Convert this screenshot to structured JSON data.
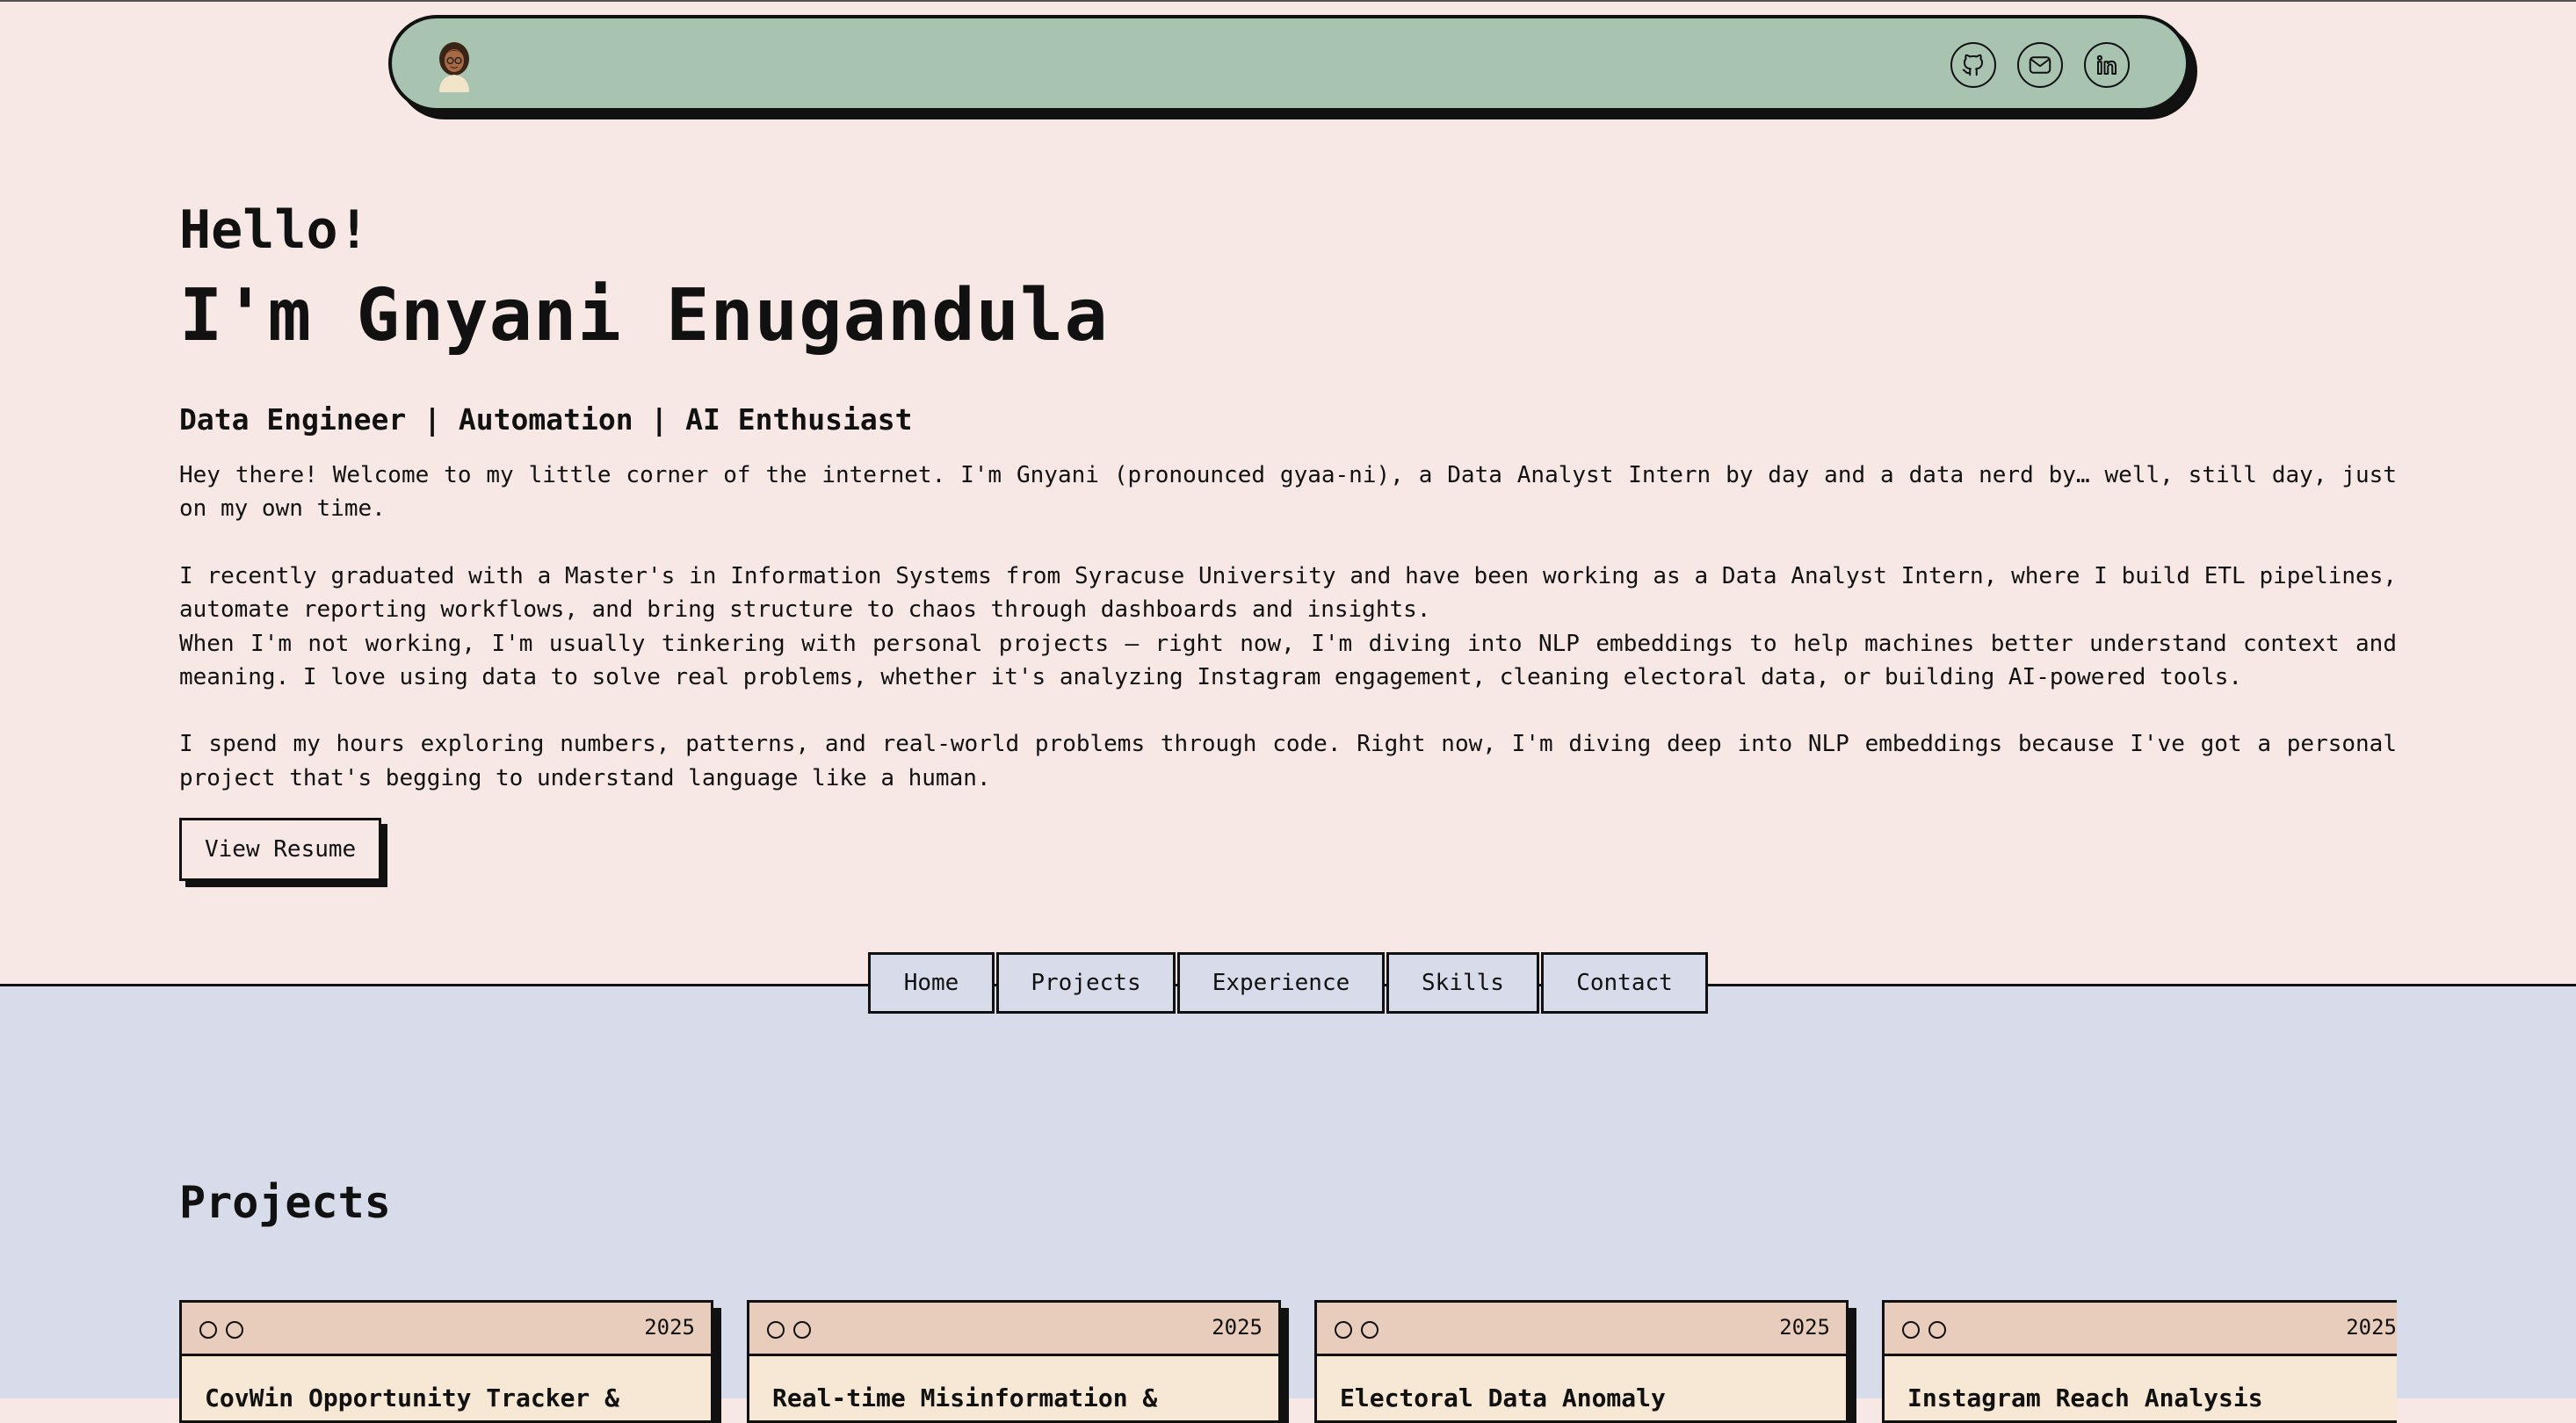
{
  "header": {
    "avatar_icon": "avatar-emoji-icon",
    "social": [
      {
        "name": "github",
        "icon": "github-icon"
      },
      {
        "name": "email",
        "icon": "mail-icon"
      },
      {
        "name": "linkedin",
        "icon": "linkedin-icon"
      }
    ]
  },
  "hero": {
    "greeting": "Hello!",
    "name": "I'm Gnyani Enugandula",
    "tagline": "Data Engineer | Automation | AI Enthusiast",
    "para1": "Hey there! Welcome to my little corner of the internet. I'm Gnyani (pronounced gyaa-ni), a Data Analyst Intern by day and a data nerd by… well, still day, just on my own time.",
    "para2": "I recently graduated with a Master's in Information Systems from Syracuse University and have been working as a Data Analyst Intern, where I build ETL pipelines, automate reporting workflows, and bring structure to chaos through dashboards and insights.",
    "para3": "When I'm not working, I'm usually tinkering with personal projects — right now, I'm diving into NLP embeddings to help machines better understand context and meaning. I love using data to solve real problems, whether it's analyzing Instagram engagement, cleaning electoral data, or building AI-powered tools.",
    "para4": "I spend my hours exploring numbers, patterns, and real-world problems through code. Right now, I'm diving deep into NLP embeddings because I've got a personal project that's begging to understand language like a human.",
    "resume_label": "View Resume"
  },
  "nav": {
    "items": [
      {
        "label": "Home"
      },
      {
        "label": "Projects"
      },
      {
        "label": "Experience"
      },
      {
        "label": "Skills"
      },
      {
        "label": "Contact"
      }
    ]
  },
  "projects": {
    "title": "Projects",
    "cards": [
      {
        "year": "2025",
        "title": "CovWin Opportunity Tracker &"
      },
      {
        "year": "2025",
        "title": "Real-time Misinformation &"
      },
      {
        "year": "2025",
        "title": "Electoral Data Anomaly"
      },
      {
        "year": "2025",
        "title": "Instagram Reach Analysis"
      }
    ]
  },
  "colors": {
    "page_bg": "#f7e8e6",
    "header_bg": "#a8c3b0",
    "lower_bg": "#d8dcea",
    "card_head": "#e8cdbd",
    "card_body": "#f7e8d6"
  }
}
